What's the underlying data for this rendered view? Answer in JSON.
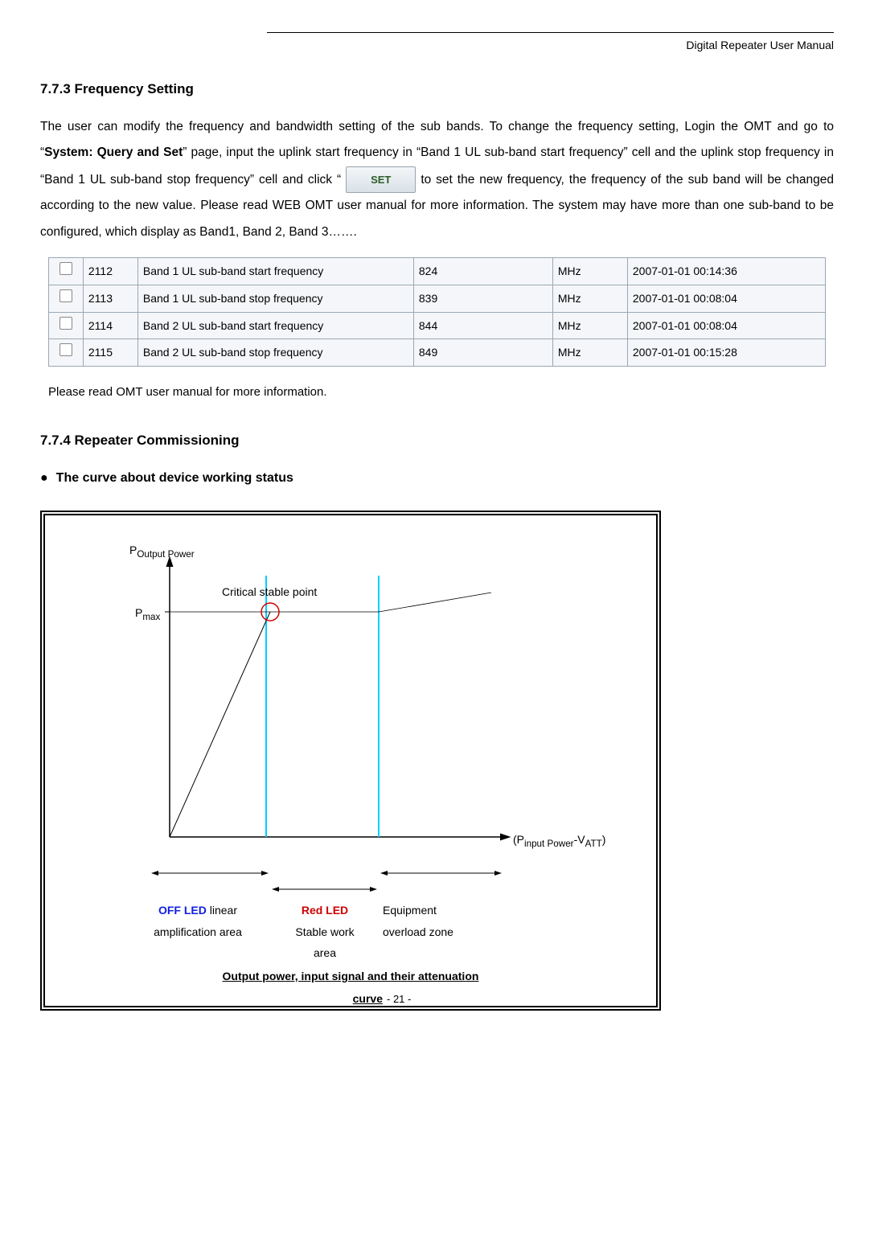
{
  "header": {
    "right": "Digital Repeater User Manual"
  },
  "sec1": {
    "heading": "7.7.3 Frequency Setting",
    "p_part1": "The user can modify the frequency and bandwidth setting of the sub bands. To change the frequency setting, Login the OMT and go to “",
    "p_bold1": "System: Query and Set",
    "p_part2": "” page, input the uplink start frequency in “Band 1 UL sub-band start frequency” cell and the uplink stop frequency in “Band 1 UL sub-band stop frequency” cell and click “",
    "set_btn": "SET",
    "p_part3": " to set the new frequency, the frequency of the sub band will be changed according to the new value. Please read WEB OMT user manual for more information. The system may have more than one sub-band to be configured, which display as Band1, Band 2, Band 3……."
  },
  "table": {
    "rows": [
      {
        "id": "2112",
        "desc": "Band 1 UL sub-band start frequency",
        "val": "824",
        "unit": "MHz",
        "ts": "2007-01-01 00:14:36"
      },
      {
        "id": "2113",
        "desc": "Band 1 UL sub-band stop frequency",
        "val": "839",
        "unit": "MHz",
        "ts": "2007-01-01 00:08:04"
      },
      {
        "id": "2114",
        "desc": "Band 2 UL sub-band start frequency",
        "val": "844",
        "unit": "MHz",
        "ts": "2007-01-01 00:08:04"
      },
      {
        "id": "2115",
        "desc": "Band 2 UL sub-band stop frequency",
        "val": "849",
        "unit": "MHz",
        "ts": "2007-01-01 00:15:28"
      }
    ]
  },
  "note": "Please read OMT user manual for more information.",
  "sec2": {
    "heading": "7.7.4 Repeater Commissioning",
    "bullet": "The curve about device working status"
  },
  "curve": {
    "y_label_main": "P",
    "y_label_sub": "Output Power",
    "y_tick_main": "P",
    "y_tick_sub": "max",
    "crit_label": "Critical stable point",
    "x_label_open": "(P",
    "x_label_sub1": "input Power",
    "x_label_mid": "-V",
    "x_label_sub2": "ATT",
    "x_label_close": ")",
    "zone1a": "OFF LED",
    "zone1b": " linear",
    "zone1c": "amplification area",
    "zone2a": "Red LED",
    "zone2b": "Stable work",
    "zone2c": "area",
    "zone3a": "Equipment",
    "zone3b": "overload zone",
    "caption1": "Output power, input signal and their attenuation ",
    "caption2": "curve"
  },
  "footer": {
    "page": "- 21 -"
  }
}
